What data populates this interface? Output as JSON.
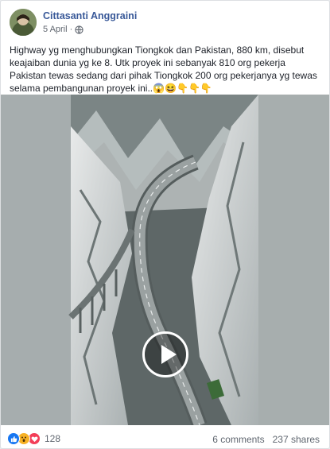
{
  "post": {
    "author": "Cittasanti Anggraini",
    "date": "5 April",
    "separator": "·",
    "privacy_icon": "globe-icon",
    "text": "Highway yg menghubungkan Tiongkok dan Pakistan, 880 km, disebut keajaiban dunia yg ke 8. Utk proyek ini sebanyak 810 org pekerja Pakistan tewas sedang dari pihak Tiongkok 200 org pekerjanya yg tewas selama pembangunan proyek ini..",
    "emojis": "😱😆👇👇👇"
  },
  "video": {
    "play_icon": "play-icon",
    "description": ""
  },
  "footer": {
    "reactions": [
      "like-icon",
      "wow-icon",
      "love-icon"
    ],
    "reaction_count": "128",
    "comments": "6 comments",
    "shares": "237 shares"
  },
  "colors": {
    "author_link": "#385898",
    "like": "#1877f2",
    "wow": "#f7b125",
    "love": "#f33e58"
  }
}
